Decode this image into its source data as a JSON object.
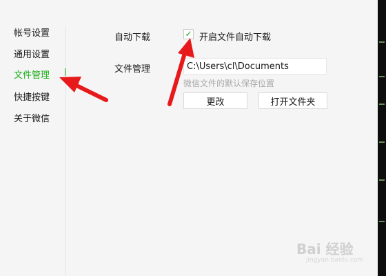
{
  "sidebar": {
    "items": [
      {
        "label": "帐号设置"
      },
      {
        "label": "通用设置"
      },
      {
        "label": "文件管理"
      },
      {
        "label": "快捷按键"
      },
      {
        "label": "关于微信"
      }
    ],
    "active_index": 2
  },
  "auto_download": {
    "label": "自动下载",
    "checkbox_label": "开启文件自动下载",
    "checked": true,
    "check_glyph": "✓"
  },
  "file_management": {
    "label": "文件管理",
    "path_value": "C:\\Users\\cl\\Documents",
    "hint": "微信文件的默认保存位置",
    "change_button": "更改",
    "open_folder_button": "打开文件夹"
  },
  "watermark": {
    "text": "Bai 经验",
    "sub": "jingyan.baidu.com"
  },
  "colors": {
    "accent": "#1aad19",
    "arrow": "#e8191b",
    "background": "#f5f5f5"
  }
}
